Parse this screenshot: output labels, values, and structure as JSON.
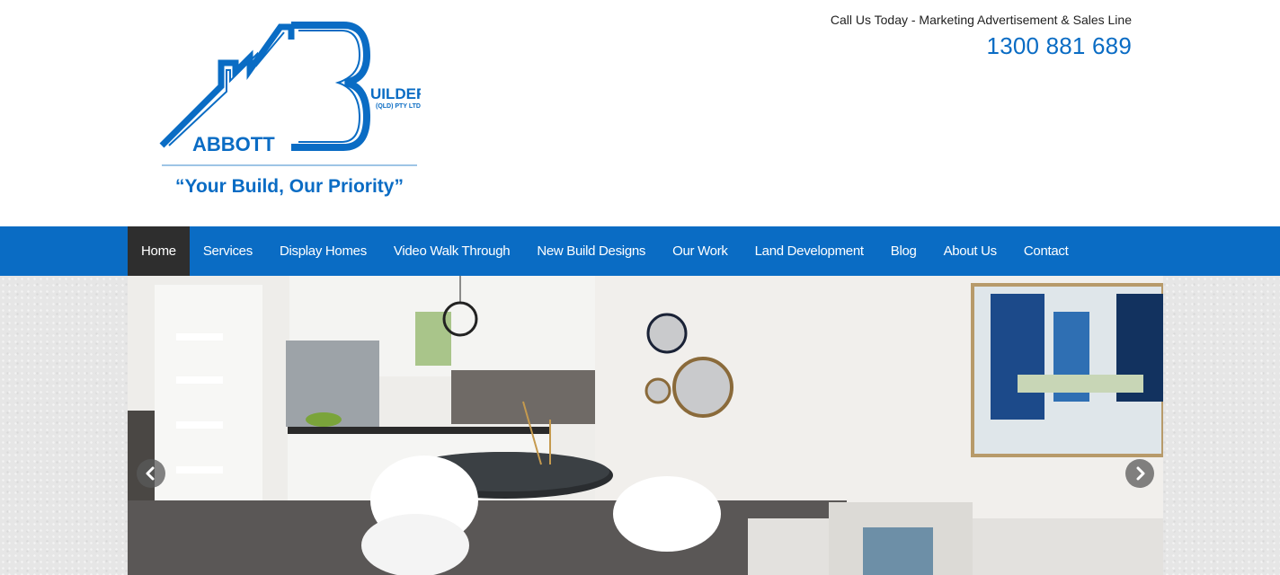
{
  "brand": {
    "logo_letters_top": "UILDERS",
    "logo_subline": "(QLD) PTY LTD",
    "logo_name": "ABBOTT",
    "tagline": "“Your Build, Our Priority”",
    "accent_color": "#0a6cc4"
  },
  "contact": {
    "call_line": "Call Us Today - Marketing Advertisement & Sales Line",
    "phone": "1300 881 689"
  },
  "nav": {
    "items": [
      {
        "label": "Home",
        "active": true
      },
      {
        "label": "Services"
      },
      {
        "label": "Display Homes"
      },
      {
        "label": "Video Walk Through"
      },
      {
        "label": "New Build Designs"
      },
      {
        "label": "Our Work"
      },
      {
        "label": "Land Development"
      },
      {
        "label": "Blog"
      },
      {
        "label": "About Us"
      },
      {
        "label": "Contact"
      }
    ]
  },
  "slider": {
    "prev_icon": "chevron-left-icon",
    "next_icon": "chevron-right-icon"
  }
}
